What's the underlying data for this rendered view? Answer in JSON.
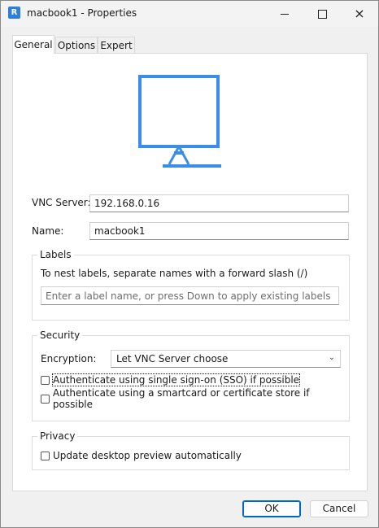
{
  "window": {
    "title": "macbook1 - Properties",
    "app_icon_glyph": "R",
    "minimize_glyph": "minimize-icon",
    "maximize_glyph": "maximize-icon",
    "close_glyph": "×"
  },
  "tabs": [
    {
      "label": "General",
      "active": true
    },
    {
      "label": "Options",
      "active": false
    },
    {
      "label": "Expert",
      "active": false
    }
  ],
  "general": {
    "icon": "monitor-icon",
    "accent_color": "#3a8ee6",
    "vnc_server": {
      "label": "VNC Server:",
      "value": "192.168.0.16"
    },
    "name": {
      "label": "Name:",
      "value": "macbook1"
    },
    "labels_group": {
      "title": "Labels",
      "hint": "To nest labels, separate names with a forward slash (/)",
      "placeholder": "Enter a label name, or press Down to apply existing labels"
    },
    "security_group": {
      "title": "Security",
      "encryption_label": "Encryption:",
      "encryption_value": "Let VNC Server choose",
      "sso_label": "Authenticate using single sign-on (SSO) if possible",
      "sso_checked": false,
      "smartcard_label": "Authenticate using a smartcard or certificate store if possible",
      "smartcard_checked": false
    },
    "privacy_group": {
      "title": "Privacy",
      "preview_label": "Update desktop preview automatically",
      "preview_checked": false
    }
  },
  "buttons": {
    "ok": "OK",
    "cancel": "Cancel"
  }
}
